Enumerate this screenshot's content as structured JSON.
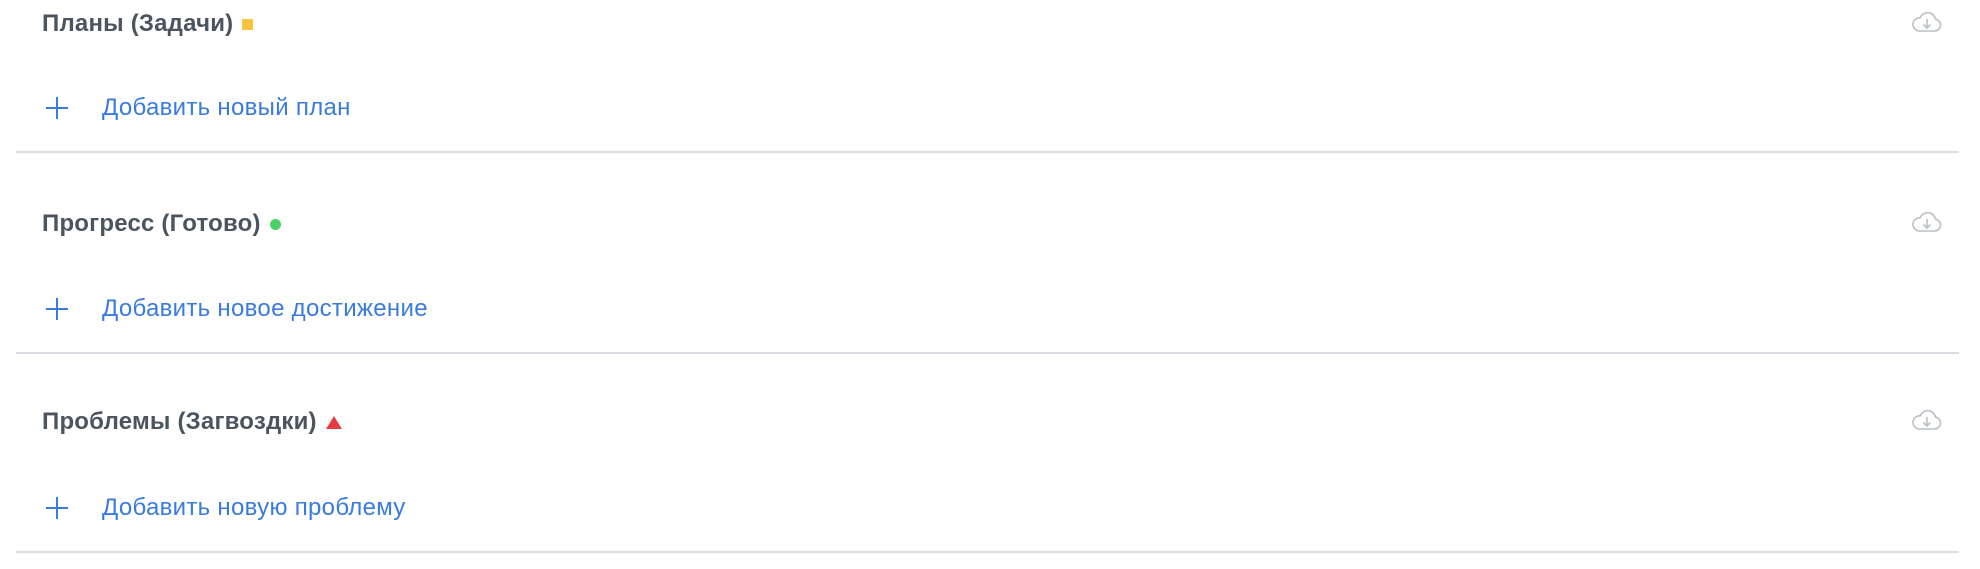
{
  "colors": {
    "title_text": "#4a5560",
    "link_blue": "#3a7be0",
    "divider": "#d9dde1",
    "icon_gray": "#b9bfc5",
    "plans_marker": "#f7c33f",
    "progress_marker": "#48d165",
    "problems_marker": "#e53c45"
  },
  "sections": [
    {
      "title": "Планы (Задачи)",
      "marker_shape": "square",
      "marker_color": "#f7c33f",
      "add_label": "Добавить новый план",
      "download_icon": "cloud-download-icon"
    },
    {
      "title": "Прогресс (Готово)",
      "marker_shape": "dot",
      "marker_color": "#48d165",
      "add_label": "Добавить новое достижение",
      "download_icon": "cloud-download-icon"
    },
    {
      "title": "Проблемы (Загвоздки)",
      "marker_shape": "triangle",
      "marker_color": "#e53c45",
      "add_label": "Добавить новую проблему",
      "download_icon": "cloud-download-icon"
    }
  ]
}
